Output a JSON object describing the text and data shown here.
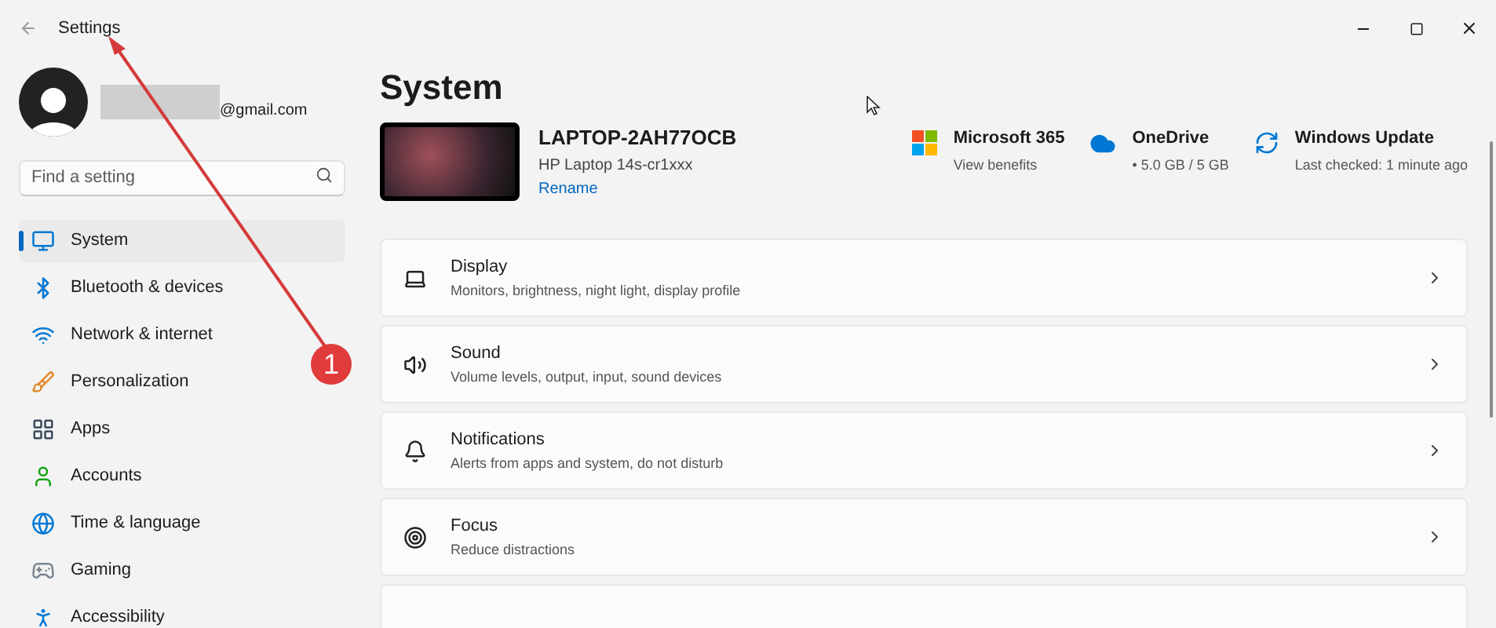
{
  "window": {
    "title": "Settings"
  },
  "account": {
    "email": "@gmail.com"
  },
  "search": {
    "placeholder": "Find a setting"
  },
  "sidebar": {
    "items": [
      {
        "label": "System",
        "selected": true
      },
      {
        "label": "Bluetooth & devices",
        "selected": false
      },
      {
        "label": "Network & internet",
        "selected": false
      },
      {
        "label": "Personalization",
        "selected": false
      },
      {
        "label": "Apps",
        "selected": false
      },
      {
        "label": "Accounts",
        "selected": false
      },
      {
        "label": "Time & language",
        "selected": false
      },
      {
        "label": "Gaming",
        "selected": false
      },
      {
        "label": "Accessibility",
        "selected": false
      }
    ]
  },
  "page": {
    "title": "System"
  },
  "device": {
    "name": "LAPTOP-2AH77OCB",
    "model": "HP Laptop 14s-cr1xxx",
    "rename": "Rename"
  },
  "tiles": [
    {
      "title": "Microsoft 365",
      "subtitle": "View benefits"
    },
    {
      "title": "OneDrive",
      "subtitle": "• 5.0 GB / 5 GB"
    },
    {
      "title": "Windows Update",
      "subtitle": "Last checked: 1 minute ago"
    }
  ],
  "settings": [
    {
      "title": "Display",
      "description": "Monitors, brightness, night light, display profile"
    },
    {
      "title": "Sound",
      "description": "Volume levels, output, input, sound devices"
    },
    {
      "title": "Notifications",
      "description": "Alerts from apps and system, do not disturb"
    },
    {
      "title": "Focus",
      "description": "Reduce distractions"
    }
  ],
  "annotation": {
    "badge": "1"
  }
}
